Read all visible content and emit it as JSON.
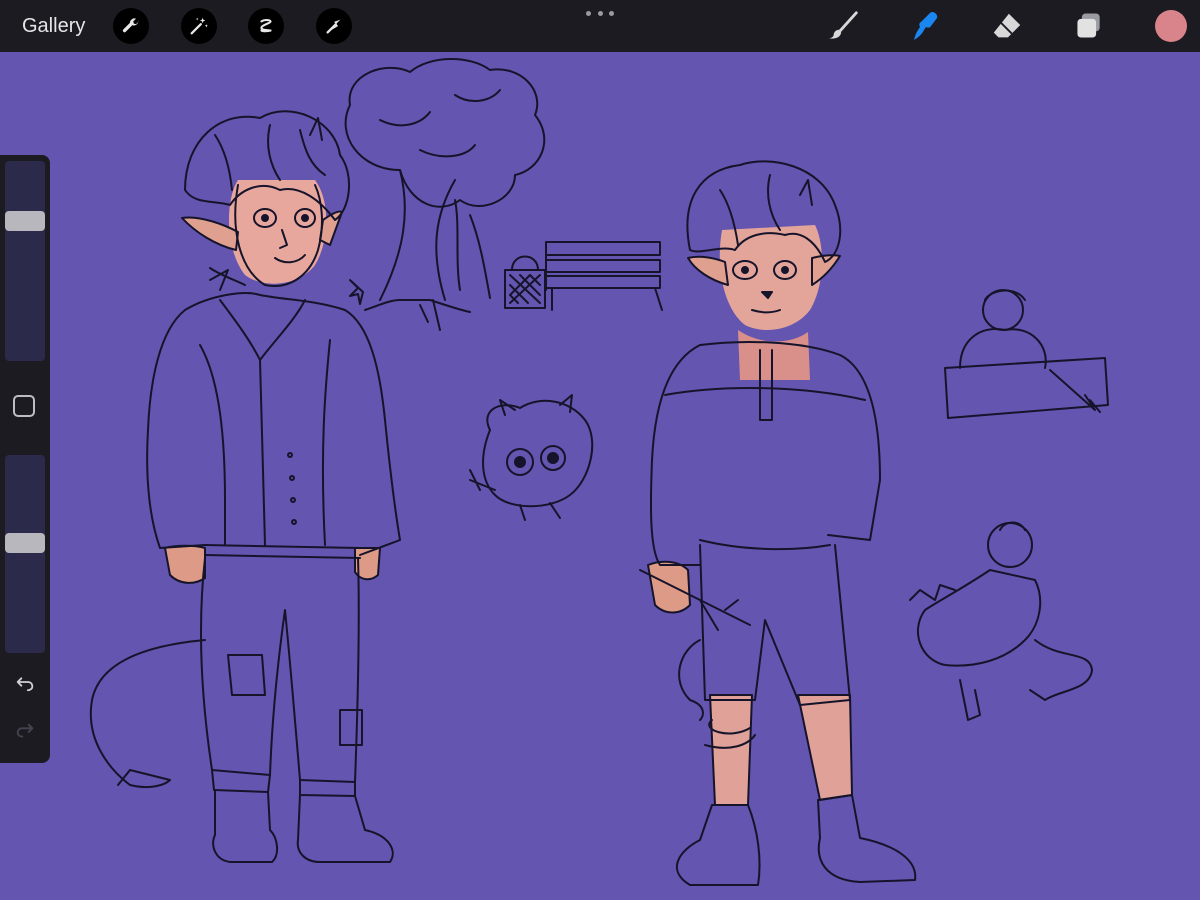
{
  "topbar": {
    "gallery_label": "Gallery",
    "left_tools": [
      "wrench-icon",
      "magic-wand-icon",
      "selection-icon",
      "transform-arrow-icon"
    ],
    "right_tools": [
      "brush-icon",
      "smudge-icon",
      "eraser-icon",
      "layers-icon"
    ],
    "active_tool": "smudge-icon",
    "active_color": "#d9838a",
    "accent_color": "#1a86f0"
  },
  "canvas": {
    "background_color": "#6355b0"
  },
  "sidebar": {
    "brush_size_level": 0.72,
    "opacity_level": 0.56,
    "buttons": [
      "modify-square-icon",
      "undo-icon",
      "redo-icon"
    ]
  }
}
